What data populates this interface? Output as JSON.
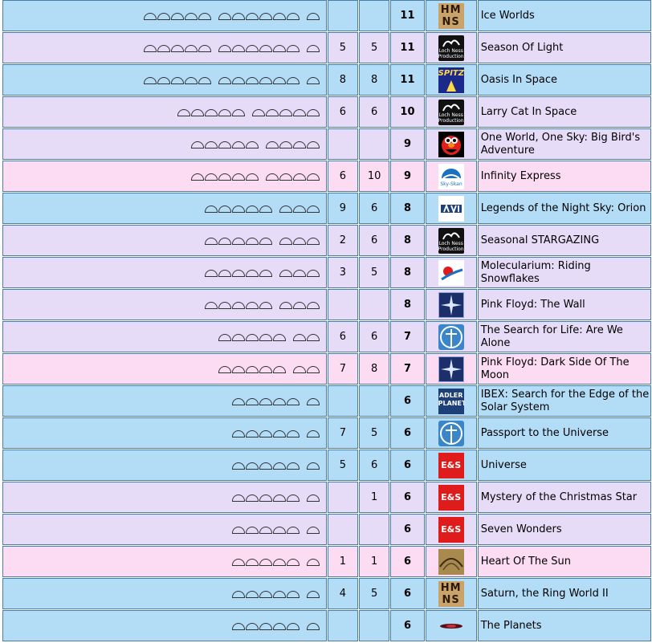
{
  "icon_names": {
    "hmns": "hmns-logo",
    "loch": "loch-ness-productions-logo",
    "spitz": "spitz-logo",
    "elmo": "elmo-logo",
    "skyskan": "sky-skan-logo",
    "avi": "avi-logo",
    "orb": "molecularium-logo",
    "star": "starburst-logo",
    "search": "search-for-life-logo",
    "adler": "adler-planetarium-logo",
    "es": "evans-sutherland-logo",
    "sun": "heart-of-the-sun-logo",
    "planets": "the-planets-logo"
  },
  "row_colors": {
    "blue": "#b3dcf7",
    "lavender": "#e6dcf7",
    "pink": "#fbdcf2"
  },
  "logo_texts": {
    "hmns": "HM NS",
    "loch": "Loch Ness Productions",
    "spitz": "SPITZ",
    "skyskan": "Sky-Skan",
    "adler": "ADLER PLANETARIUM",
    "es": "E&S"
  },
  "rows": [
    {
      "color": "blue",
      "domes": [
        5,
        6,
        1
      ],
      "a": "",
      "b": "",
      "total": "11",
      "logo": "hmns",
      "title": "Ice Worlds"
    },
    {
      "color": "lav",
      "domes": [
        5,
        6,
        1
      ],
      "a": "5",
      "b": "5",
      "total": "11",
      "logo": "loch",
      "title": "Season Of Light"
    },
    {
      "color": "blue",
      "domes": [
        5,
        6,
        1
      ],
      "a": "8",
      "b": "8",
      "total": "11",
      "logo": "spitz",
      "title": "Oasis In Space"
    },
    {
      "color": "lav",
      "domes": [
        5,
        5
      ],
      "a": "6",
      "b": "6",
      "total": "10",
      "logo": "loch",
      "title": "Larry Cat In Space"
    },
    {
      "color": "lav",
      "domes": [
        5,
        4
      ],
      "a": "",
      "b": "",
      "total": "9",
      "logo": "elmo",
      "title": "One World, One Sky: Big Bird's Adventure"
    },
    {
      "color": "pink",
      "domes": [
        5,
        4
      ],
      "a": "6",
      "b": "10",
      "total": "9",
      "logo": "skyskan",
      "title": "Infinity Express"
    },
    {
      "color": "blue",
      "domes": [
        5,
        3
      ],
      "a": "9",
      "b": "6",
      "total": "8",
      "logo": "avi",
      "title": "Legends of the Night Sky: Orion"
    },
    {
      "color": "lav",
      "domes": [
        5,
        3
      ],
      "a": "2",
      "b": "6",
      "total": "8",
      "logo": "loch",
      "title": "Seasonal STARGAZING"
    },
    {
      "color": "lav",
      "domes": [
        5,
        3
      ],
      "a": "3",
      "b": "5",
      "total": "8",
      "logo": "orb",
      "title": "Molecularium: Riding Snowflakes"
    },
    {
      "color": "lav",
      "domes": [
        5,
        3
      ],
      "a": "",
      "b": "",
      "total": "8",
      "logo": "star",
      "title": "Pink Floyd: The Wall"
    },
    {
      "color": "lav",
      "domes": [
        5,
        2
      ],
      "a": "6",
      "b": "6",
      "total": "7",
      "logo": "search",
      "title": "The Search for Life: Are We Alone"
    },
    {
      "color": "pink",
      "domes": [
        5,
        2
      ],
      "a": "7",
      "b": "8",
      "total": "7",
      "logo": "star",
      "title": "Pink Floyd: Dark Side Of The Moon"
    },
    {
      "color": "blue",
      "domes": [
        5,
        1
      ],
      "a": "",
      "b": "",
      "total": "6",
      "logo": "adler",
      "title": "IBEX: Search for the Edge of the Solar System"
    },
    {
      "color": "blue",
      "domes": [
        5,
        1
      ],
      "a": "7",
      "b": "5",
      "total": "6",
      "logo": "search",
      "title": "Passport to the Universe"
    },
    {
      "color": "blue",
      "domes": [
        5,
        1
      ],
      "a": "5",
      "b": "6",
      "total": "6",
      "logo": "es",
      "title": "Universe"
    },
    {
      "color": "lav",
      "domes": [
        5,
        1
      ],
      "a": "",
      "b": "1",
      "total": "6",
      "logo": "es",
      "title": "Mystery of the Christmas Star"
    },
    {
      "color": "lav",
      "domes": [
        5,
        1
      ],
      "a": "",
      "b": "",
      "total": "6",
      "logo": "es",
      "title": "Seven Wonders"
    },
    {
      "color": "pink",
      "domes": [
        5,
        1
      ],
      "a": "1",
      "b": "1",
      "total": "6",
      "logo": "sun",
      "title": "Heart Of The Sun"
    },
    {
      "color": "blue",
      "domes": [
        5,
        1
      ],
      "a": "4",
      "b": "5",
      "total": "6",
      "logo": "hmns",
      "title": "Saturn, the Ring World II"
    },
    {
      "color": "blue",
      "domes": [
        5,
        1
      ],
      "a": "",
      "b": "",
      "total": "6",
      "logo": "planets",
      "title": "The Planets"
    }
  ]
}
